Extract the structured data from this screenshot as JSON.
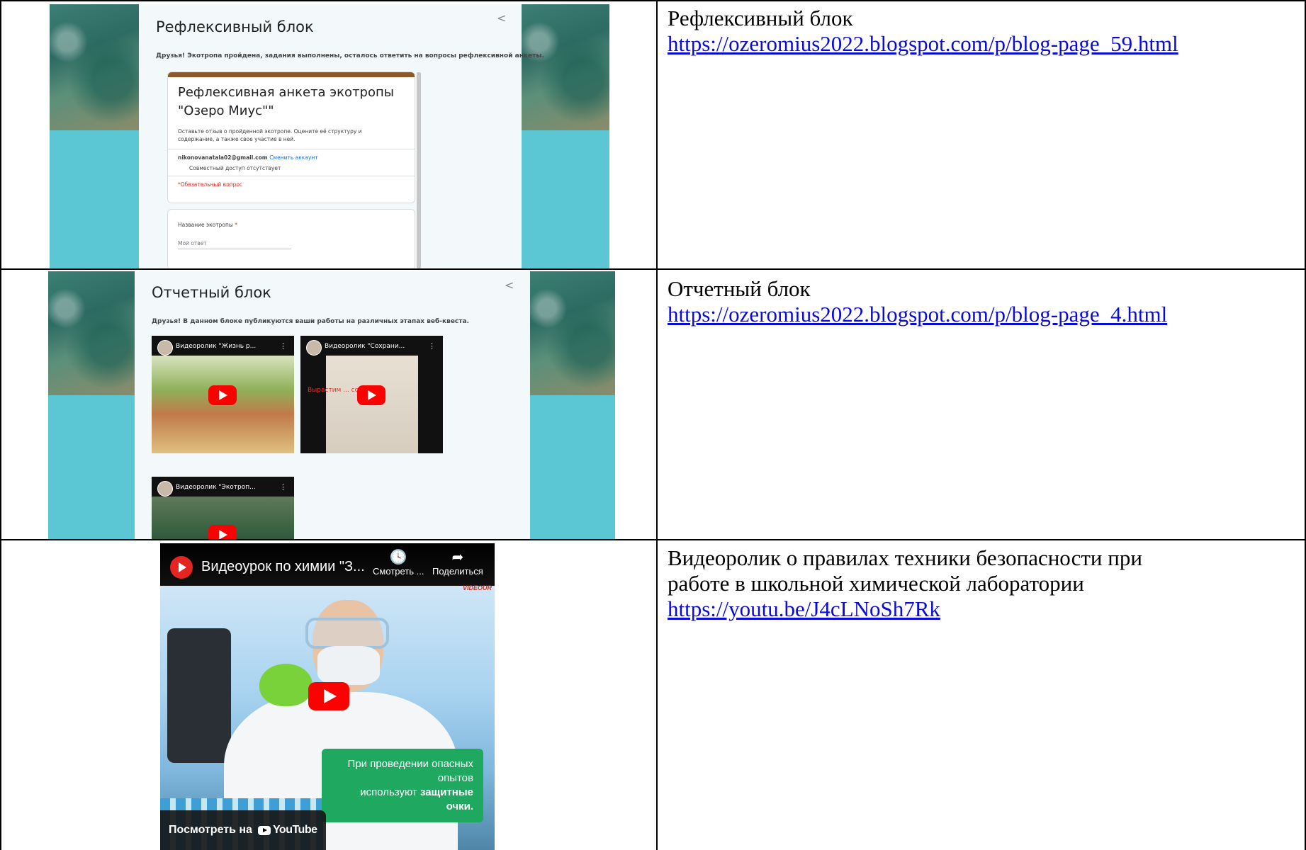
{
  "rows": [
    {
      "label": "Рефлексивный блок",
      "url": "https://ozeromius2022.blogspot.com/p/blog-page_59.html",
      "screenshot": {
        "page_title": "Рефлексивный блок",
        "intro": "Друзья! Экотропа пройдена, задания выполнены, осталось ответить на вопросы рефлексивной анкеты.",
        "form_title_line1": "Рефлексивная анкета экотропы",
        "form_title_line2": "\"Озеро Миус\"\"",
        "form_desc_line1": "Оставьте отзыв о пройденной экотропе. Оцените её структуру и",
        "form_desc_line2": "содержание, а также свое участие в ней.",
        "account_email": "nikonovanatala02@gmail.com",
        "switch_account": "Сменить аккаунт",
        "no_sharing": "Совместный доступ отсутствует",
        "required_note": "*Обязательный вопрос",
        "question_label": "Название экотропы",
        "question_required_mark": "*",
        "answer_placeholder": "Мой ответ"
      }
    },
    {
      "label": "Отчетный блок",
      "url": "https://ozeromius2022.blogspot.com/p/blog-page_4.html",
      "screenshot": {
        "page_title": "Отчетный блок",
        "intro": "Друзья! В данном блоке публикуются ваши работы на различных этапах веб-квеста.",
        "videos": [
          {
            "title": "Видеоролик \"Жизнь р..."
          },
          {
            "title": "Видеоролик \"Сохрани..."
          },
          {
            "title": "Видеоролик \"Экотроп..."
          }
        ],
        "thumb2_overlay": "Вырастим ... солнца"
      }
    },
    {
      "label": "Видеоролик о правилах техники безопасности при работе в школьной химической лаборатории",
      "label_line1": "Видеоролик о правилах техники безопасности при",
      "label_line2": "работе в школьной химической лаборатории",
      "url": "https://youtu.be/J4cLNoSh7Rk",
      "video": {
        "title": "Видеоурок по химии \"З...",
        "watch_later": "Смотреть ...",
        "share": "Поделиться",
        "watermark": "VIDEOUR",
        "caption_line1": "При проведении опасных опытов",
        "caption_line2_prefix": "используют ",
        "caption_line2_bold": "защитные очки.",
        "watch_on": "Посмотреть на",
        "youtube": "YouTube"
      }
    }
  ],
  "colors": {
    "link": "#0b0bd6",
    "teal": "#5bc7d4",
    "youtube_red": "#ff0000",
    "form_accent": "#8b5a2b",
    "caption_green": "#1fa85f"
  }
}
